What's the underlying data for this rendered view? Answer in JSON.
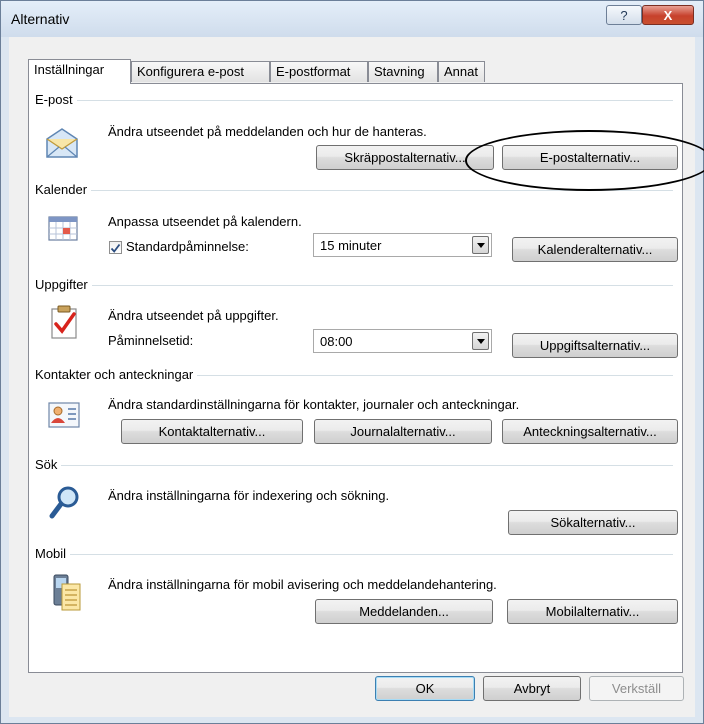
{
  "window": {
    "title": "Alternativ",
    "help_glyph": "?",
    "close_glyph": "X"
  },
  "tabs": [
    "Inställningar",
    "Konfigurera e-post",
    "E-postformat",
    "Stavning",
    "Annat"
  ],
  "sections": {
    "email": {
      "label": "E-post",
      "description": "Ändra utseendet på meddelanden och hur de hanteras.",
      "icon": "envelope-icon",
      "buttons": [
        "Skräppostalternativ...",
        "E-postalternativ..."
      ]
    },
    "calendar": {
      "label": "Kalender",
      "description": "Anpassa utseendet på kalendern.",
      "icon": "calendar-icon",
      "reminder_label": "Standardpåminnelse:",
      "reminder_checked": true,
      "reminder_value": "15 minuter",
      "button": "Kalenderalternativ..."
    },
    "tasks": {
      "label": "Uppgifter",
      "description": "Ändra utseendet på uppgifter.",
      "icon": "task-icon",
      "reminder_label": "Påminnelsetid:",
      "reminder_value": "08:00",
      "button": "Uppgiftsalternativ..."
    },
    "contacts": {
      "label": "Kontakter och anteckningar",
      "description": "Ändra standardinställningarna för kontakter, journaler och anteckningar.",
      "icon": "contact-card-icon",
      "buttons": [
        "Kontaktalternativ...",
        "Journalalternativ...",
        "Anteckningsalternativ..."
      ]
    },
    "search": {
      "label": "Sök",
      "description": "Ändra inställningarna för indexering och sökning.",
      "icon": "magnifier-icon",
      "button": "Sökalternativ..."
    },
    "mobile": {
      "label": "Mobil",
      "description": "Ändra inställningarna för mobil avisering och meddelandehantering.",
      "icon": "mobile-icon",
      "buttons": [
        "Meddelanden...",
        "Mobilalternativ..."
      ]
    }
  },
  "footer": {
    "ok": "OK",
    "cancel": "Avbryt",
    "apply": "Verkställ"
  }
}
